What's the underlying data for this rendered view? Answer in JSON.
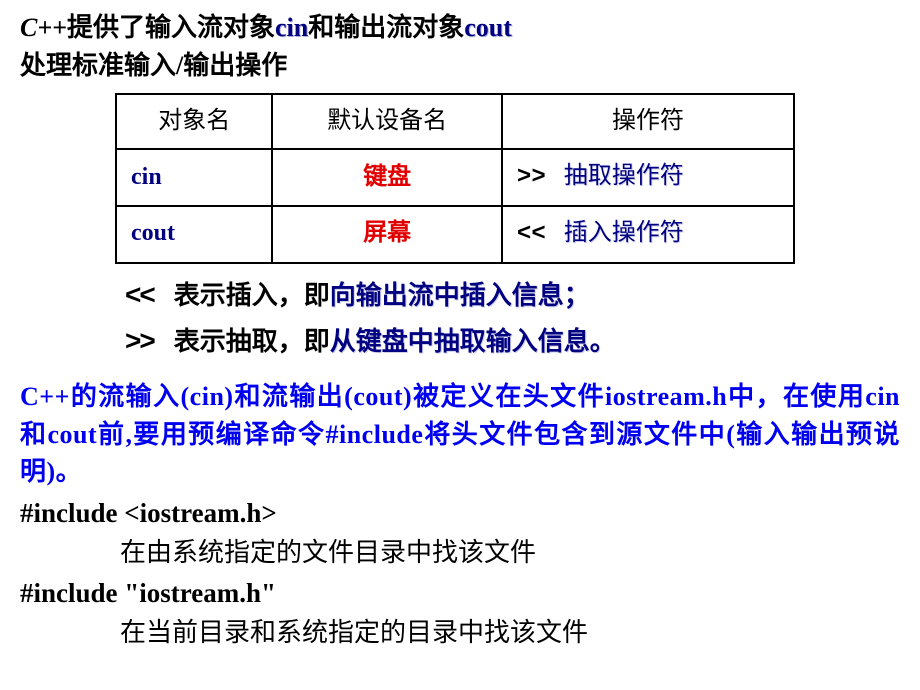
{
  "title": {
    "cpp": "C++",
    "t1_a": "提供了输入流对象",
    "cin": "cin",
    "t1_b": "和输出流对象",
    "cout": "cout",
    "t2": "处理标准输入/输出操作"
  },
  "table": {
    "headers": {
      "c1": "对象名",
      "c2": "默认设备名",
      "c3": "操作符"
    },
    "rows": [
      {
        "obj": "cin",
        "device": "键盘",
        "op": ">>",
        "op_desc": "抽取操作符"
      },
      {
        "obj": "cout",
        "device": "屏幕",
        "op": "<<",
        "op_desc": "插入操作符"
      }
    ]
  },
  "ops": {
    "line1_sym": "<<",
    "line1_a": "表示插入，即",
    "line1_b": "向输出流中插入信息；",
    "line2_sym": ">>",
    "line2_a": "表示抽取，即",
    "line2_b": "从键盘中抽取输入信息。"
  },
  "para": "C++的流输入(cin)和流输出(cout)被定义在头文件iostream.h中，在使用cin 和cout前,要用预编译命令#include将头文件包含到源文件中(输入输出预说明)。",
  "includes": {
    "code1": "#include  <iostream.h>",
    "note1": "在由系统指定的文件目录中找该文件",
    "code2": "#include \"iostream.h\"",
    "note2": "在当前目录和系统指定的目录中找该文件"
  }
}
